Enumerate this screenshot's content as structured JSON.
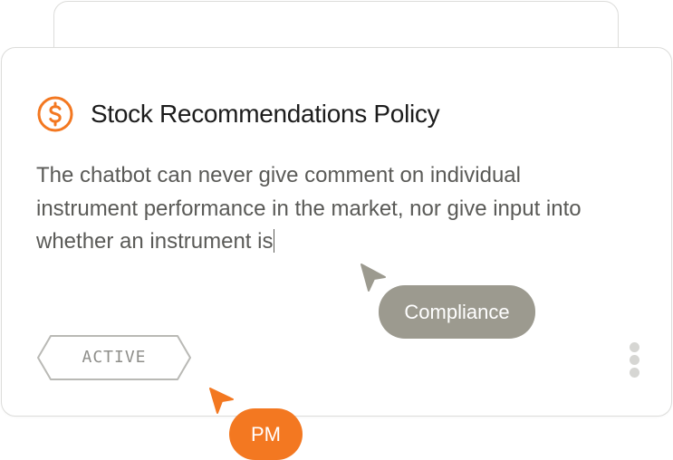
{
  "policy_card": {
    "title": "Stock Recommendations Policy",
    "icon": "dollar-circle-icon",
    "body": "The chatbot can never give comment on individual instrument performance in the market, nor give input into whether an instrument is",
    "status": "ACTIVE"
  },
  "collaborators": [
    {
      "label": "Compliance",
      "color": "#9c9a8f"
    },
    {
      "label": "PM",
      "color": "#f37821"
    }
  ],
  "colors": {
    "accent": "#f37821",
    "text": "#1c1c1c",
    "muted_text": "#5a5a57"
  }
}
